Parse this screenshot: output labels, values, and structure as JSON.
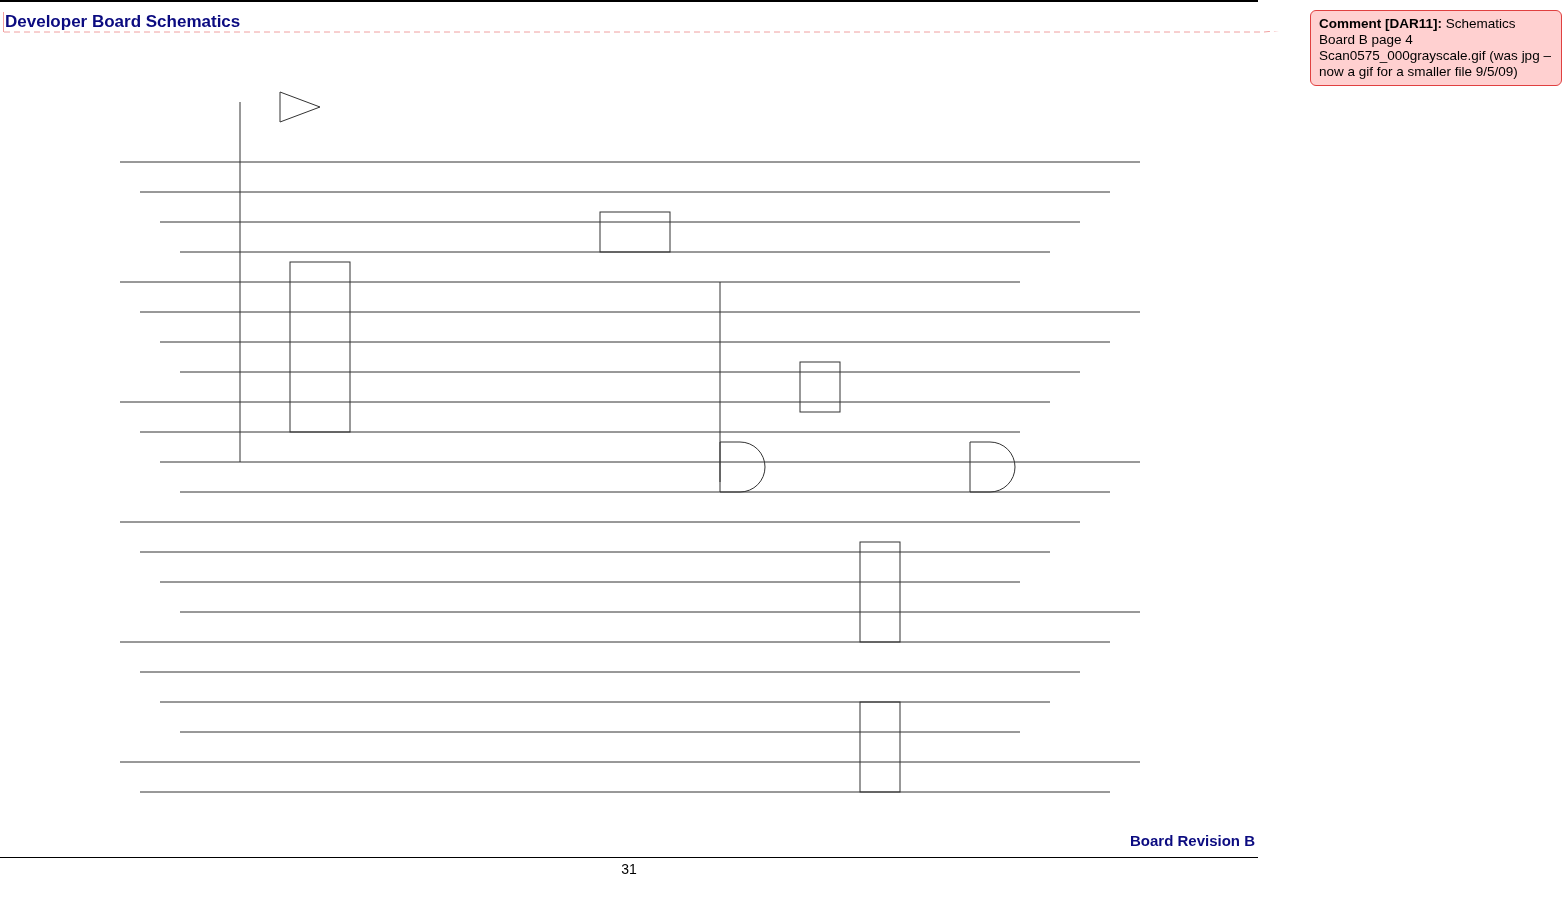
{
  "heading": "Developer Board Schematics",
  "comment": {
    "text": "**Comment [DAR11]:** Schematics Board B page 4 Scan0575_000grayscale.gif (was jpg – now a gif for a smaller file 9/5/09)"
  },
  "caption": "Board Revision B",
  "page_number": "31"
}
